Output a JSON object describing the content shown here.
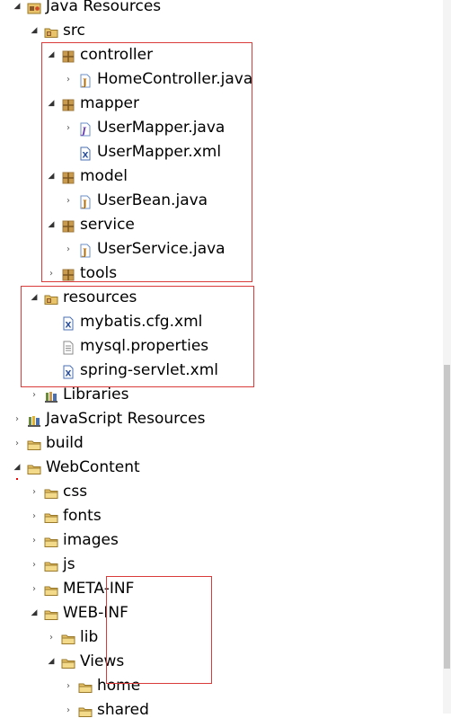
{
  "tree": [
    {
      "label": "Java Resources",
      "icon": "java-resources-icon",
      "twisty": "expanded"
    },
    {
      "label": "src",
      "icon": "source-folder-icon",
      "twisty": "expanded"
    },
    {
      "label": "controller",
      "icon": "package-icon",
      "twisty": "expanded"
    },
    {
      "label": "HomeController.java",
      "icon": "java-file-icon",
      "twisty": "collapsed"
    },
    {
      "label": "mapper",
      "icon": "package-icon",
      "twisty": "expanded"
    },
    {
      "label": "UserMapper.java",
      "icon": "java-interface-file-icon",
      "twisty": "collapsed"
    },
    {
      "label": "UserMapper.xml",
      "icon": "xml-file-icon",
      "twisty": "none"
    },
    {
      "label": "model",
      "icon": "package-icon",
      "twisty": "expanded"
    },
    {
      "label": "UserBean.java",
      "icon": "java-file-icon",
      "twisty": "collapsed"
    },
    {
      "label": "service",
      "icon": "package-icon",
      "twisty": "expanded"
    },
    {
      "label": "UserService.java",
      "icon": "java-file-icon",
      "twisty": "collapsed"
    },
    {
      "label": "tools",
      "icon": "package-icon",
      "twisty": "collapsed"
    },
    {
      "label": "resources",
      "icon": "source-folder-icon",
      "twisty": "expanded"
    },
    {
      "label": "mybatis.cfg.xml",
      "icon": "xml-file-icon",
      "twisty": "none"
    },
    {
      "label": "mysql.properties",
      "icon": "text-file-icon",
      "twisty": "none"
    },
    {
      "label": "spring-servlet.xml",
      "icon": "xml-file-icon",
      "twisty": "none"
    },
    {
      "label": "Libraries",
      "icon": "libraries-icon",
      "twisty": "collapsed"
    },
    {
      "label": "JavaScript Resources",
      "icon": "javascript-resources-icon",
      "twisty": "collapsed"
    },
    {
      "label": "build",
      "icon": "folder-icon",
      "twisty": "collapsed"
    },
    {
      "label": "WebContent",
      "icon": "folder-icon",
      "twisty": "expanded"
    },
    {
      "label": "css",
      "icon": "folder-icon",
      "twisty": "collapsed"
    },
    {
      "label": "fonts",
      "icon": "folder-icon",
      "twisty": "collapsed"
    },
    {
      "label": "images",
      "icon": "folder-icon",
      "twisty": "collapsed"
    },
    {
      "label": "js",
      "icon": "folder-icon",
      "twisty": "collapsed"
    },
    {
      "label": "META-INF",
      "icon": "folder-icon",
      "twisty": "collapsed"
    },
    {
      "label": "WEB-INF",
      "icon": "folder-icon",
      "twisty": "expanded"
    },
    {
      "label": "lib",
      "icon": "folder-icon",
      "twisty": "collapsed"
    },
    {
      "label": "Views",
      "icon": "folder-icon",
      "twisty": "expanded"
    },
    {
      "label": "home",
      "icon": "folder-icon",
      "twisty": "collapsed"
    },
    {
      "label": "shared",
      "icon": "folder-icon",
      "twisty": "collapsed"
    }
  ],
  "colors": {
    "highlight_box": "#d93a3a",
    "folder": "#e8c36a",
    "package": "#a07a3c",
    "java_file": "#6b8fc5",
    "xml_file": "#4a6fb0"
  }
}
